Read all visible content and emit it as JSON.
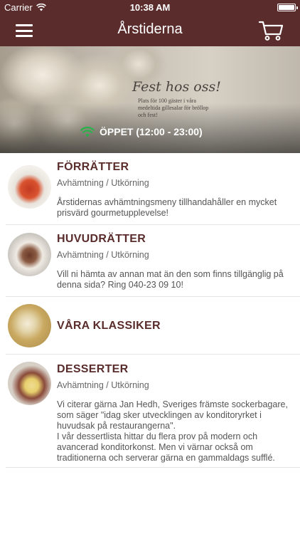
{
  "status_bar": {
    "carrier": "Carrier",
    "time": "10:38 AM"
  },
  "nav": {
    "title": "Årstiderna",
    "menu_icon": "hamburger-menu-icon",
    "cart_icon": "shopping-cart-icon"
  },
  "banner": {
    "headline": "Fest hos oss!",
    "tagline": "Plats för 100 gäster i våra medeltida gillesalar för bröllop och fest!",
    "open_status": "ÖPPET (12:00 - 23:00)",
    "status_icon": "wifi-signal-icon",
    "status_color": "#28b34a"
  },
  "colors": {
    "brand": "#5a2c2c",
    "background": "#ffffff"
  },
  "categories": [
    {
      "title": "FÖRRÄTTER",
      "subtitle": "Avhämtning / Utkörning",
      "description": "Årstidernas avhämtningsmeny tillhandahåller en mycket prisvärd gourmetupplevelse!"
    },
    {
      "title": "HUVUDRÄTTER",
      "subtitle": "Avhämtning / Utkörning",
      "description": "Vill ni hämta av annan mat än den som finns tillgänglig på denna sida? Ring 040-23 09 10!"
    },
    {
      "title": "VÅRA KLASSIKER"
    },
    {
      "title": "DESSERTER",
      "subtitle": "Avhämtning / Utkörning",
      "description": "Vi citerar gärna Jan Hedh, Sveriges främste sockerbagare, som säger \"idag sker utvecklingen av konditoryrket i huvudsak på restaurangerna\".\nI vår dessertlista hittar du flera prov på modern och avancerad konditorkonst. Men vi värnar också om traditionerna och serverar gärna en gammaldags sufflé."
    }
  ]
}
